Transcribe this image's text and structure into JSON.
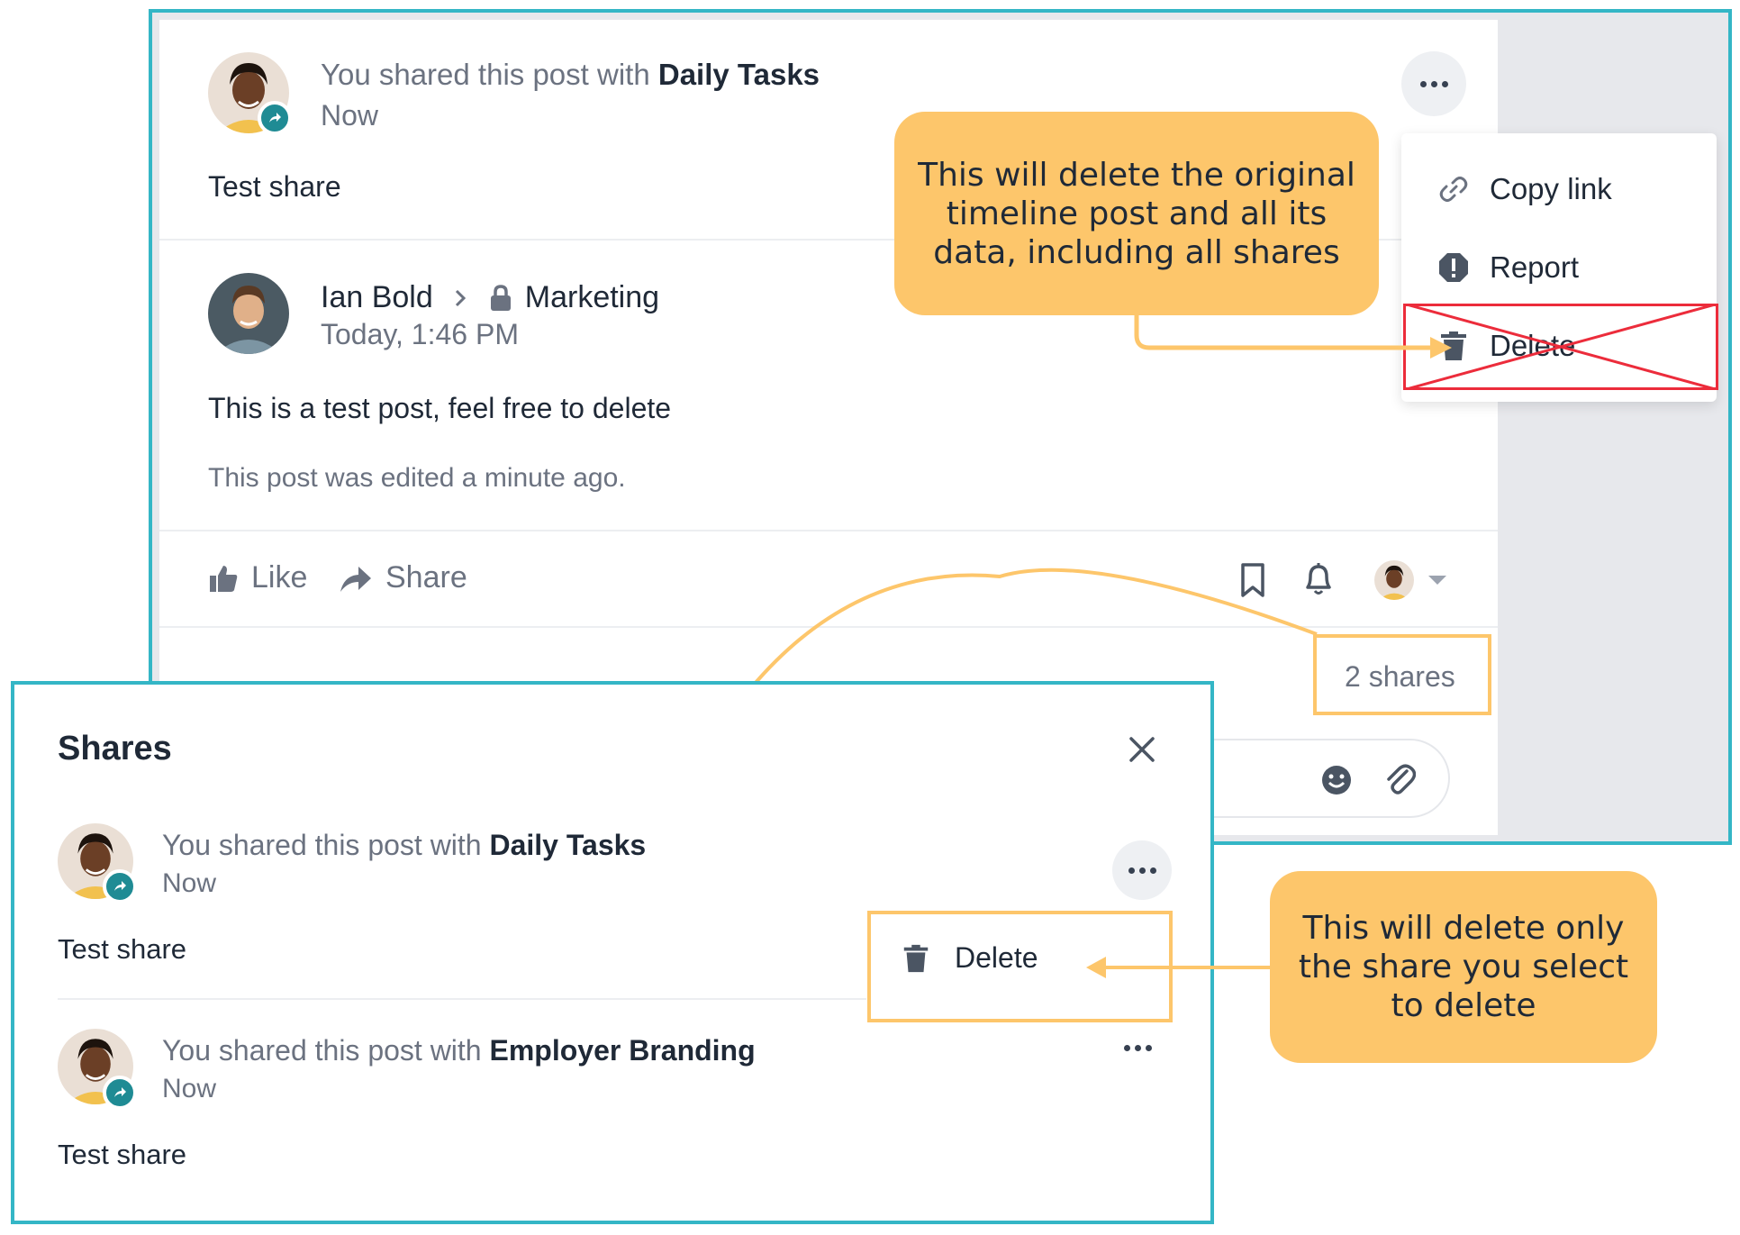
{
  "timeline_post": {
    "share_header": {
      "prefix": "You shared this post with",
      "target": "Daily Tasks",
      "time": "Now",
      "body": "Test share"
    },
    "original": {
      "author": "Ian Bold",
      "space": "Marketing",
      "time": "Today, 1:46 PM",
      "body": "This is a test post, feel free to delete",
      "edited_note": "This post was edited a minute ago."
    },
    "actions": {
      "like_label": "Like",
      "share_label": "Share"
    },
    "shares_count": "2 shares"
  },
  "post_menu": {
    "items": [
      {
        "label": "Copy link",
        "icon": "link-icon"
      },
      {
        "label": "Report",
        "icon": "report-icon"
      },
      {
        "label": "Delete",
        "icon": "trash-icon"
      }
    ]
  },
  "shares_modal": {
    "title": "Shares",
    "items": [
      {
        "prefix": "You shared this post with",
        "target": "Daily Tasks",
        "time": "Now",
        "body": "Test share"
      },
      {
        "prefix": "You shared this post with",
        "target": "Employer Branding",
        "time": "Now",
        "body": "Test share"
      }
    ],
    "item_menu": {
      "delete_label": "Delete"
    }
  },
  "callouts": {
    "delete_original": "This will delete the original timeline post and all its data, including all shares",
    "delete_share": "This will delete only the share you select to delete"
  },
  "colors": {
    "frame": "#34b6c6",
    "callout": "#fdc66b",
    "strike": "#ec2c3b",
    "badge": "#1f8b94"
  }
}
